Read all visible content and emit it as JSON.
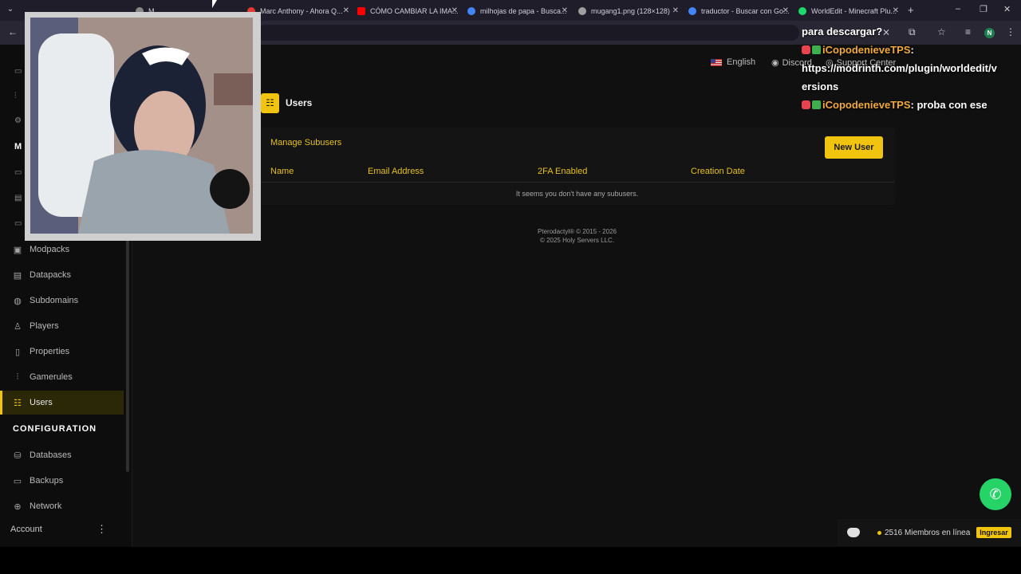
{
  "browser": {
    "tabs": [
      {
        "title": "",
        "favicon_color": "#555555"
      },
      {
        "title": "M...",
        "favicon_color": "#888888"
      },
      {
        "title": "Marc Anthony - Ahora Q...",
        "favicon_color": "#e53935"
      },
      {
        "title": "CÓMO CAMBIAR LA IMA...",
        "favicon_color": "#ff0000"
      },
      {
        "title": "milhojas de papa - Busca...",
        "favicon_color": "#4285f4"
      },
      {
        "title": "mugang1.png (128×128)",
        "favicon_color": "#9e9e9e"
      },
      {
        "title": "traductor - Buscar con Go...",
        "favicon_color": "#4285f4"
      },
      {
        "title": "WorldEdit - Minecraft Plu...",
        "favicon_color": "#1bd96a"
      }
    ],
    "profile_initial": "N"
  },
  "header": {
    "language": "English",
    "discord": "Discord",
    "support": "Support Center"
  },
  "sidebar": {
    "partial_top": "M",
    "items": [
      {
        "label": "Modpacks",
        "icon": "package-icon"
      },
      {
        "label": "Datapacks",
        "icon": "archive-icon"
      },
      {
        "label": "Subdomains",
        "icon": "globe-icon"
      },
      {
        "label": "Players",
        "icon": "player-icon"
      },
      {
        "label": "Properties",
        "icon": "document-icon"
      },
      {
        "label": "Gamerules",
        "icon": "sliders-icon"
      },
      {
        "label": "Users",
        "icon": "users-icon",
        "active": true
      }
    ],
    "configuration_heading": "CONFIGURATION",
    "config_items": [
      {
        "label": "Databases",
        "icon": "database-icon"
      },
      {
        "label": "Backups",
        "icon": "backup-icon"
      },
      {
        "label": "Network",
        "icon": "network-icon"
      }
    ],
    "account_label": "Account"
  },
  "main": {
    "title": "Users",
    "card_title": "Manage Subusers",
    "new_user_label": "New User",
    "columns": [
      "Name",
      "Email Address",
      "2FA Enabled",
      "Creation Date"
    ],
    "empty_message": "It seems you don't have any subusers.",
    "footer_line1": "Pterodactyl® © 2015 - 2026",
    "footer_line2": "© 2025 Holy Servers LLC."
  },
  "chat": {
    "line0": "para descargar?",
    "msg1_user": "iCopodenieveTPS",
    "msg1_text": "https://modrinth.com/plugin/worldedit/versions",
    "msg2_user": "iCopodenieveTPS",
    "msg2_text": "proba con ese"
  },
  "discord_widget": {
    "members": "2516 Miembros en línea",
    "join_label": "Ingresar"
  },
  "colors": {
    "accent": "#f1c40f",
    "background": "#101010",
    "sidebar": "#0d0d0d"
  }
}
